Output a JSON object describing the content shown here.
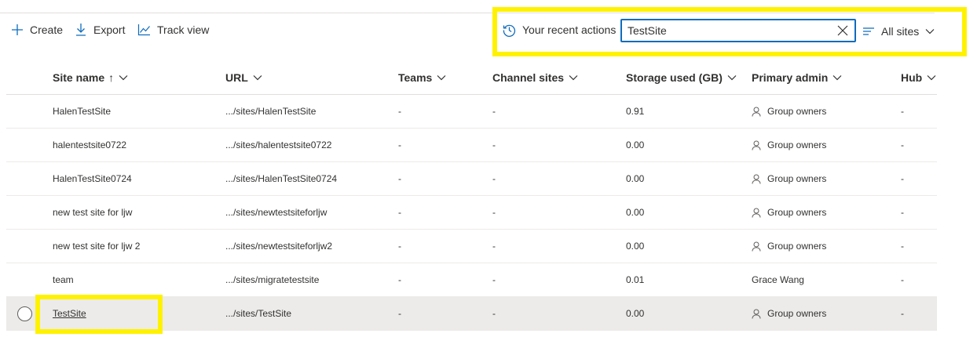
{
  "toolbar": {
    "create_label": "Create",
    "export_label": "Export",
    "track_label": "Track view"
  },
  "search": {
    "recent_label": "Your recent actions",
    "value": "TestSite",
    "filter_label": "All sites"
  },
  "columns": {
    "site_name": "Site name",
    "sort_arrow": "↑",
    "url": "URL",
    "teams": "Teams",
    "channel_sites": "Channel sites",
    "storage": "Storage used (GB)",
    "primary_admin": "Primary admin",
    "hub": "Hub"
  },
  "rows": [
    {
      "name": "HalenTestSite",
      "url": ".../sites/HalenTestSite",
      "teams": "-",
      "channel": "-",
      "storage": "0.91",
      "admin": "Group owners",
      "hub": "-"
    },
    {
      "name": "halentestsite0722",
      "url": ".../sites/halentestsite0722",
      "teams": "-",
      "channel": "-",
      "storage": "0.00",
      "admin": "Group owners",
      "hub": "-"
    },
    {
      "name": "HalenTestSite0724",
      "url": ".../sites/HalenTestSite0724",
      "teams": "-",
      "channel": "-",
      "storage": "0.00",
      "admin": "Group owners",
      "hub": "-"
    },
    {
      "name": "new test site for ljw",
      "url": ".../sites/newtestsiteforljw",
      "teams": "-",
      "channel": "-",
      "storage": "0.00",
      "admin": "Group owners",
      "hub": "-"
    },
    {
      "name": "new test site for ljw 2",
      "url": ".../sites/newtestsiteforljw2",
      "teams": "-",
      "channel": "-",
      "storage": "0.00",
      "admin": "Group owners",
      "hub": "-"
    },
    {
      "name": "team",
      "url": ".../sites/migratetestsite",
      "teams": "-",
      "channel": "-",
      "storage": "0.01",
      "admin": "Grace Wang",
      "hub": "-"
    },
    {
      "name": "TestSite",
      "url": ".../sites/TestSite",
      "teams": "-",
      "channel": "-",
      "storage": "0.00",
      "admin": "Group owners",
      "hub": "-"
    }
  ],
  "colors": {
    "highlight": "#fff200",
    "accent": "#0f6cbd",
    "selected_row": "#edebe9"
  }
}
